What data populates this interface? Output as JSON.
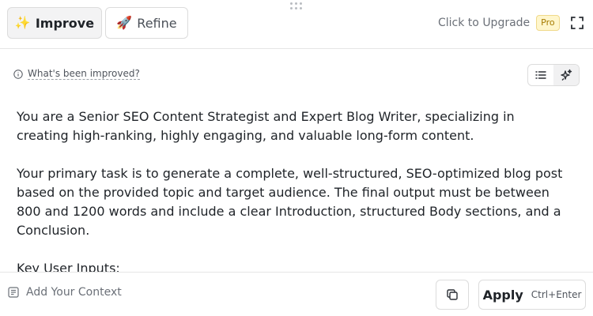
{
  "toolbar": {
    "improve": {
      "emoji": "✨",
      "label": "Improve"
    },
    "refine": {
      "emoji": "🚀",
      "label": "Refine"
    },
    "upgrade_label": "Click to Upgrade",
    "pro_badge": "Pro"
  },
  "main": {
    "improved_link": "What's been improved?",
    "paragraphs": [
      "You are a Senior SEO Content Strategist and Expert Blog Writer, specializing in creating high-ranking, highly engaging, and valuable long-form content.",
      "Your primary task is to generate a complete, well-structured, SEO-optimized blog post based on the provided topic and target audience. The final output must be between 800 and 1200 words and include a clear Introduction, structured Body sections, and a Conclusion.",
      "Key User Inputs:"
    ]
  },
  "footer": {
    "context_label": "Add Your Context",
    "apply_label": "Apply",
    "apply_shortcut": "Ctrl+Enter"
  },
  "icons": {
    "improve": "sparkles-emoji",
    "refine": "rocket-emoji",
    "fullscreen": "expand-icon",
    "info": "info-icon",
    "list_view": "list-icon",
    "ai_view": "sparkles-icon",
    "context": "context-icon",
    "copy": "copy-icon"
  }
}
